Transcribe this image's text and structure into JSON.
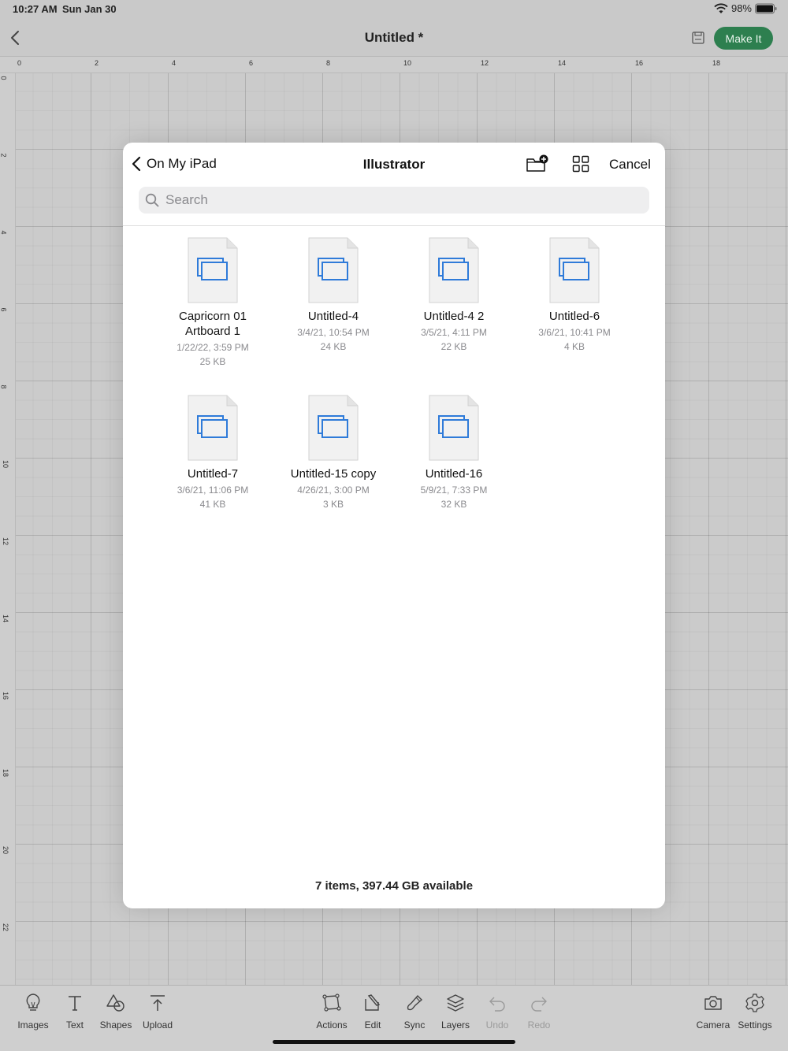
{
  "status_bar": {
    "time": "10:27 AM",
    "date": "Sun Jan 30",
    "battery": "98%"
  },
  "header": {
    "title": "Untitled *",
    "make_it_label": "Make It"
  },
  "ruler": {
    "top_labels": [
      "0",
      "2",
      "4",
      "6",
      "8",
      "10",
      "12",
      "14",
      "16",
      "18"
    ],
    "left_labels": [
      "0",
      "2",
      "4",
      "6",
      "8",
      "10",
      "12",
      "14",
      "16",
      "18",
      "20",
      "22"
    ]
  },
  "picker": {
    "back_label": "On My iPad",
    "title": "Illustrator",
    "cancel_label": "Cancel",
    "search_placeholder": "Search",
    "search_value": "",
    "files": [
      {
        "name": "Capricorn 01 Artboard 1",
        "date": "1/22/22, 3:59 PM",
        "size": "25 KB"
      },
      {
        "name": "Untitled-4",
        "date": "3/4/21, 10:54 PM",
        "size": "24 KB"
      },
      {
        "name": "Untitled-4 2",
        "date": "3/5/21, 4:11 PM",
        "size": "22 KB"
      },
      {
        "name": "Untitled-6",
        "date": "3/6/21, 10:41 PM",
        "size": "4 KB"
      },
      {
        "name": "Untitled-7",
        "date": "3/6/21, 11:06 PM",
        "size": "41 KB"
      },
      {
        "name": "Untitled-15 copy",
        "date": "4/26/21, 3:00 PM",
        "size": "3 KB"
      },
      {
        "name": "Untitled-16",
        "date": "5/9/21, 7:33 PM",
        "size": "32 KB"
      }
    ],
    "footer": "7 items, 397.44 GB available"
  },
  "toolbar": {
    "images": "Images",
    "text": "Text",
    "shapes": "Shapes",
    "upload": "Upload",
    "actions": "Actions",
    "edit": "Edit",
    "sync": "Sync",
    "layers": "Layers",
    "undo": "Undo",
    "redo": "Redo",
    "camera": "Camera",
    "settings": "Settings"
  },
  "colors": {
    "accent_green": "#2d7f4f",
    "file_icon_blue": "#2f7bd9"
  },
  "icons": {
    "back": "chevron-left-icon",
    "save": "save-icon",
    "new_folder": "folder-plus-icon",
    "grid_view": "grid-view-icon",
    "search": "search-icon",
    "file": "document-icon"
  }
}
